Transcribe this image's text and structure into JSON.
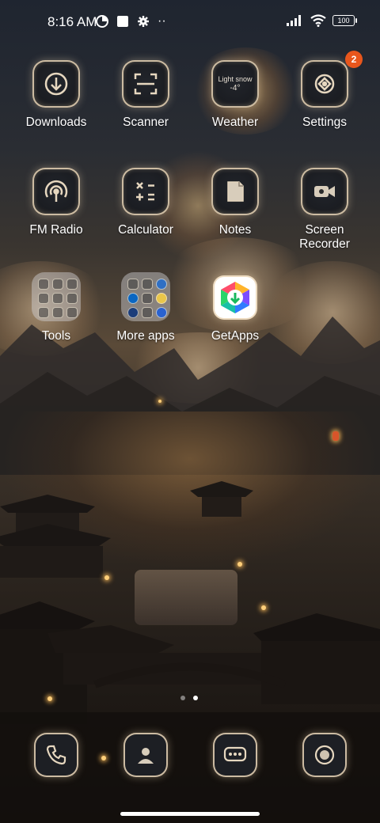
{
  "status_bar": {
    "time": "8:16 AM",
    "battery": "100",
    "more": "··"
  },
  "apps": [
    {
      "label": "Downloads",
      "icon": "downloads-icon"
    },
    {
      "label": "Scanner",
      "icon": "scanner-icon"
    },
    {
      "label": "Weather",
      "icon": "weather-icon",
      "weather_condition": "Light snow",
      "weather_temp": "-4°"
    },
    {
      "label": "Settings",
      "icon": "settings-icon",
      "badge": "2"
    },
    {
      "label": "FM Radio",
      "icon": "fm-radio-icon"
    },
    {
      "label": "Calculator",
      "icon": "calculator-icon"
    },
    {
      "label": "Notes",
      "icon": "notes-icon"
    },
    {
      "label": "Screen\nRecorder",
      "icon": "screen-recorder-icon"
    },
    {
      "label": "Tools",
      "icon": "tools-folder-icon"
    },
    {
      "label": "More apps",
      "icon": "more-apps-folder-icon"
    },
    {
      "label": "GetApps",
      "icon": "getapps-icon"
    }
  ],
  "dock": [
    {
      "icon": "phone-icon"
    },
    {
      "icon": "contacts-icon"
    },
    {
      "icon": "messages-icon"
    },
    {
      "icon": "camera-icon"
    }
  ],
  "pages": {
    "count": 2,
    "active": 1
  },
  "colors": {
    "badge": "#e8561c",
    "icon_border": "#ebd7b9"
  }
}
